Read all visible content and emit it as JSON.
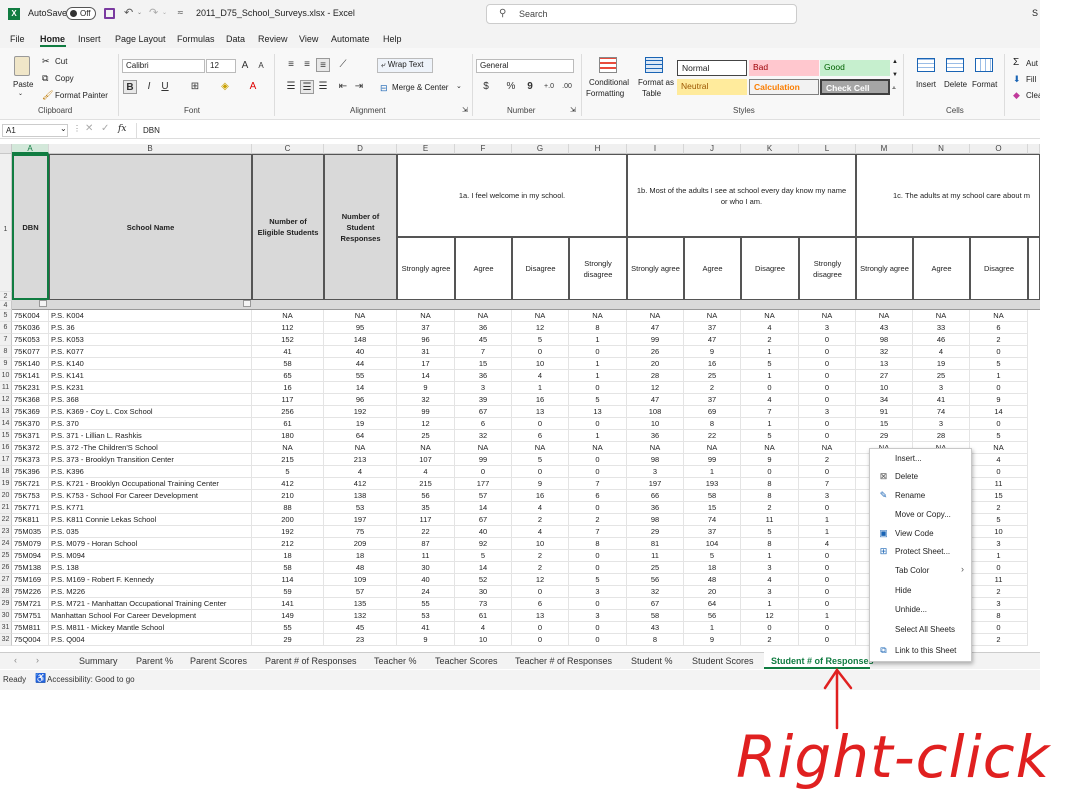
{
  "titlebar": {
    "autosave": "AutoSave",
    "toggle": "Off",
    "filename": "2011_D75_School_Surveys.xlsx - Excel",
    "search_placeholder": "Search",
    "edge": "S"
  },
  "menu": [
    "File",
    "Home",
    "Insert",
    "Page Layout",
    "Formulas",
    "Data",
    "Review",
    "View",
    "Automate",
    "Help"
  ],
  "ribbon": {
    "clipboard": {
      "paste": "Paste",
      "cut": "Cut",
      "copy": "Copy",
      "format_painter": "Format Painter",
      "label": "Clipboard"
    },
    "font": {
      "name": "Calibri",
      "size": "12",
      "label": "Font"
    },
    "alignment": {
      "wrap": "Wrap Text",
      "merge": "Merge & Center",
      "label": "Alignment"
    },
    "number": {
      "format": "General",
      "label": "Number"
    },
    "styles": {
      "cond1": "Conditional",
      "cond2": "Formatting",
      "fmt1": "Format as",
      "fmt2": "Table",
      "normal": "Normal",
      "bad": "Bad",
      "good": "Good",
      "neutral": "Neutral",
      "calculation": "Calculation",
      "check": "Check Cell",
      "label": "Styles"
    },
    "cells": {
      "insert": "Insert",
      "delete": "Delete",
      "format": "Format",
      "label": "Cells"
    },
    "editing": {
      "autosum": "Aut",
      "fill": "Fill",
      "clear": "Clea"
    }
  },
  "formula": {
    "namebox": "A1",
    "fx": "fx",
    "value": "DBN"
  },
  "colors": {
    "excel_green": "#107c41",
    "bad_bg": "#ffc7ce",
    "bad_fg": "#9c0006",
    "good_bg": "#c6efce",
    "good_fg": "#006100",
    "neutral_bg": "#ffeb9c",
    "neutral_fg": "#9c5700",
    "calc_bg": "#f2f2f2",
    "calc_fg": "#fa7d00",
    "check_bg": "#a5a5a5",
    "annotation": "#e02020"
  },
  "sheet": {
    "col_letters": [
      "A",
      "B",
      "C",
      "D",
      "E",
      "F",
      "G",
      "H",
      "I",
      "J",
      "K",
      "L",
      "M",
      "N",
      "O"
    ],
    "header": {
      "dbn": "DBN",
      "school": "School Name",
      "eligible": "Number of Eligible Students",
      "responses": "Number of Student Responses",
      "q1a": "1a. I feel welcome in my school.",
      "q1b": "1b. Most of the adults I see at school every day know my name or who I am.",
      "q1c": "1c. The adults at my school care about m",
      "sub": [
        "Strongly agree",
        "Agree",
        "Disagree",
        "Strongly disagree",
        "Strongly agree",
        "Agree",
        "Disagree",
        "Strongly disagree",
        "Strongly agree",
        "Agree",
        "Disagree"
      ]
    },
    "hdr_row_nums": [
      "1",
      "2",
      "4"
    ],
    "rows": [
      {
        "r": "5",
        "v": [
          "75K004",
          "P.S. K004",
          "NA",
          "NA",
          "NA",
          "NA",
          "NA",
          "NA",
          "NA",
          "NA",
          "NA",
          "NA",
          "NA",
          "NA",
          "NA"
        ]
      },
      {
        "r": "6",
        "v": [
          "75K036",
          "P.S. 36",
          "112",
          "95",
          "37",
          "36",
          "12",
          "8",
          "47",
          "37",
          "4",
          "3",
          "43",
          "33",
          "6"
        ]
      },
      {
        "r": "7",
        "v": [
          "75K053",
          "P.S. K053",
          "152",
          "148",
          "96",
          "45",
          "5",
          "1",
          "99",
          "47",
          "2",
          "0",
          "98",
          "46",
          "2"
        ]
      },
      {
        "r": "8",
        "v": [
          "75K077",
          "P.S. K077",
          "41",
          "40",
          "31",
          "7",
          "0",
          "0",
          "26",
          "9",
          "1",
          "0",
          "32",
          "4",
          "0"
        ]
      },
      {
        "r": "9",
        "v": [
          "75K140",
          "P.S. K140",
          "58",
          "44",
          "17",
          "15",
          "10",
          "1",
          "20",
          "16",
          "5",
          "0",
          "13",
          "19",
          "5"
        ]
      },
      {
        "r": "10",
        "v": [
          "75K141",
          "P.S. K141",
          "65",
          "55",
          "14",
          "36",
          "4",
          "1",
          "28",
          "25",
          "1",
          "0",
          "27",
          "25",
          "1"
        ]
      },
      {
        "r": "11",
        "v": [
          "75K231",
          "P.S. K231",
          "16",
          "14",
          "9",
          "3",
          "1",
          "0",
          "12",
          "2",
          "0",
          "0",
          "10",
          "3",
          "0"
        ]
      },
      {
        "r": "12",
        "v": [
          "75K368",
          "P.S. 368",
          "117",
          "96",
          "32",
          "39",
          "16",
          "5",
          "47",
          "37",
          "4",
          "0",
          "34",
          "41",
          "9"
        ]
      },
      {
        "r": "13",
        "v": [
          "75K369",
          "P.S. K369 - Coy L. Cox School",
          "256",
          "192",
          "99",
          "67",
          "13",
          "13",
          "108",
          "69",
          "7",
          "3",
          "91",
          "74",
          "14"
        ]
      },
      {
        "r": "14",
        "v": [
          "75K370",
          "P.S. 370",
          "61",
          "19",
          "12",
          "6",
          "0",
          "0",
          "10",
          "8",
          "1",
          "0",
          "15",
          "3",
          "0"
        ]
      },
      {
        "r": "15",
        "v": [
          "75K371",
          "P.S. 371 - Lillian L. Rashkis",
          "180",
          "64",
          "25",
          "32",
          "6",
          "1",
          "36",
          "22",
          "5",
          "0",
          "29",
          "28",
          "5"
        ]
      },
      {
        "r": "16",
        "v": [
          "75K372",
          "P.S. 372 -The Children'S School",
          "NA",
          "NA",
          "NA",
          "NA",
          "NA",
          "NA",
          "NA",
          "NA",
          "NA",
          "NA",
          "NA",
          "NA",
          "NA"
        ]
      },
      {
        "r": "17",
        "v": [
          "75K373",
          "P.S. 373 - Brooklyn Transition Center",
          "215",
          "213",
          "107",
          "99",
          "5",
          "0",
          "98",
          "99",
          "9",
          "2",
          "",
          "",
          "4"
        ]
      },
      {
        "r": "18",
        "v": [
          "75K396",
          "P.S. K396",
          "5",
          "4",
          "4",
          "0",
          "0",
          "0",
          "3",
          "1",
          "0",
          "0",
          "",
          "",
          "0"
        ]
      },
      {
        "r": "19",
        "v": [
          "75K721",
          "P.S. K721 - Brooklyn Occupational Training Center",
          "412",
          "412",
          "215",
          "177",
          "9",
          "7",
          "197",
          "193",
          "8",
          "7",
          "",
          "",
          "11"
        ]
      },
      {
        "r": "20",
        "v": [
          "75K753",
          "P.S. K753 - School For Career Development",
          "210",
          "138",
          "56",
          "57",
          "16",
          "6",
          "66",
          "58",
          "8",
          "3",
          "",
          "",
          "15"
        ]
      },
      {
        "r": "21",
        "v": [
          "75K771",
          "P.S. K771",
          "88",
          "53",
          "35",
          "14",
          "4",
          "0",
          "36",
          "15",
          "2",
          "0",
          "",
          "",
          "2"
        ]
      },
      {
        "r": "22",
        "v": [
          "75K811",
          "P.S. K811 Connie Lekas School",
          "200",
          "197",
          "117",
          "67",
          "2",
          "2",
          "98",
          "74",
          "11",
          "1",
          "",
          "",
          "5"
        ]
      },
      {
        "r": "23",
        "v": [
          "75M035",
          "P.S. 035",
          "192",
          "75",
          "22",
          "40",
          "4",
          "7",
          "29",
          "37",
          "5",
          "1",
          "",
          "",
          "10"
        ]
      },
      {
        "r": "24",
        "v": [
          "75M079",
          "P.S. M079 - Horan School",
          "212",
          "209",
          "87",
          "92",
          "10",
          "8",
          "81",
          "104",
          "8",
          "4",
          "",
          "",
          "3"
        ]
      },
      {
        "r": "25",
        "v": [
          "75M094",
          "P.S. M094",
          "18",
          "18",
          "11",
          "5",
          "2",
          "0",
          "11",
          "5",
          "1",
          "0",
          "",
          "",
          "1"
        ]
      },
      {
        "r": "26",
        "v": [
          "75M138",
          "P.S. 138",
          "58",
          "48",
          "30",
          "14",
          "2",
          "0",
          "25",
          "18",
          "3",
          "0",
          "",
          "",
          "0"
        ]
      },
      {
        "r": "27",
        "v": [
          "75M169",
          "P.S. M169 - Robert F. Kennedy",
          "114",
          "109",
          "40",
          "52",
          "12",
          "5",
          "56",
          "48",
          "4",
          "0",
          "",
          "",
          "11"
        ]
      },
      {
        "r": "28",
        "v": [
          "75M226",
          "P.S. M226",
          "59",
          "57",
          "24",
          "30",
          "0",
          "3",
          "32",
          "20",
          "3",
          "0",
          "",
          "",
          "2"
        ]
      },
      {
        "r": "29",
        "v": [
          "75M721",
          "P.S. M721 - Manhattan Occupational Training Center",
          "141",
          "135",
          "55",
          "73",
          "6",
          "0",
          "67",
          "64",
          "1",
          "0",
          "",
          "",
          "3"
        ]
      },
      {
        "r": "30",
        "v": [
          "75M751",
          "Manhattan School For Career Development",
          "149",
          "132",
          "53",
          "61",
          "13",
          "3",
          "58",
          "56",
          "12",
          "1",
          "",
          "",
          "8"
        ]
      },
      {
        "r": "31",
        "v": [
          "75M811",
          "P.S. M811 - Mickey Mantle School",
          "55",
          "45",
          "41",
          "4",
          "0",
          "0",
          "43",
          "1",
          "0",
          "0",
          "",
          "",
          "0"
        ]
      },
      {
        "r": "32",
        "v": [
          "75Q004",
          "P.S. Q004",
          "29",
          "23",
          "9",
          "10",
          "0",
          "0",
          "8",
          "9",
          "2",
          "0",
          "",
          "",
          "2"
        ]
      }
    ]
  },
  "sheet_tabs": [
    "Summary",
    "Parent %",
    "Parent Scores",
    "Parent # of Responses",
    "Teacher %",
    "Teacher Scores",
    "Teacher # of Responses",
    "Student %",
    "Student Scores",
    "Student # of Responses"
  ],
  "active_tab": "Student # of Responses",
  "status": {
    "ready": "Ready",
    "accessibility": "Accessibility: Good to go"
  },
  "context_menu": [
    {
      "label": "Insert...",
      "icon": ""
    },
    {
      "label": "Delete",
      "icon": "delete-sheet-icon"
    },
    {
      "label": "Rename",
      "icon": "rename-icon"
    },
    {
      "label": "Move or Copy...",
      "icon": ""
    },
    {
      "label": "View Code",
      "icon": "view-code-icon"
    },
    {
      "label": "Protect Sheet...",
      "icon": "protect-sheet-icon"
    },
    {
      "label": "Tab Color",
      "icon": ""
    },
    {
      "label": "Hide",
      "icon": ""
    },
    {
      "label": "Unhide...",
      "icon": ""
    },
    {
      "label": "Select All Sheets",
      "icon": ""
    },
    {
      "label": "Link to this Sheet",
      "icon": "link-sheet-icon"
    }
  ],
  "annotation": {
    "text": "Right-click"
  }
}
